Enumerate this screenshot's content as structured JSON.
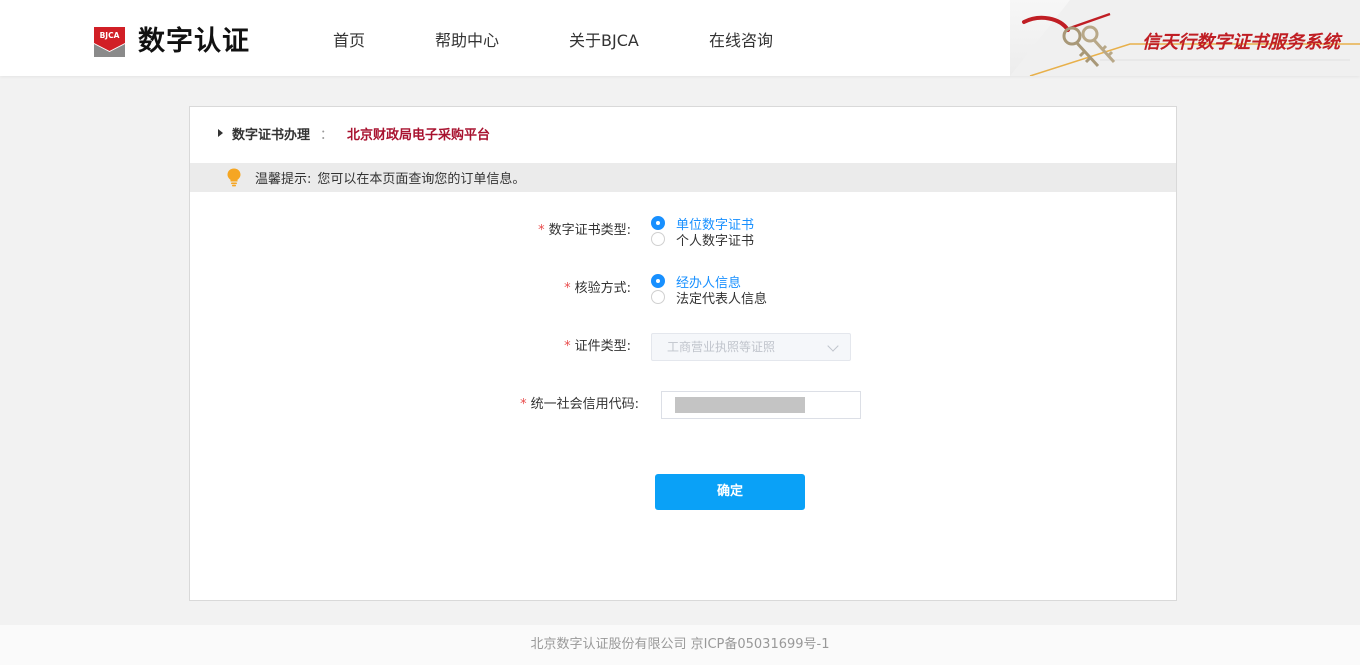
{
  "header": {
    "logo_badge": "BJCA",
    "logo_text": "数字认证",
    "nav": [
      "首页",
      "帮助中心",
      "关于BJCA",
      "在线咨询"
    ],
    "brand_title": "信天行数字证书服务系统"
  },
  "breadcrumb": {
    "main": "数字证书办理",
    "separator": "：",
    "sub": "北京财政局电子采购平台"
  },
  "tip": {
    "label": "温馨提示:",
    "text": "您可以在本页面查询您的订单信息。"
  },
  "form": {
    "cert_type": {
      "label": "数字证书类型:",
      "options": [
        "单位数字证书",
        "个人数字证书"
      ],
      "selected": "单位数字证书"
    },
    "verify_method": {
      "label": "核验方式:",
      "options": [
        "经办人信息",
        "法定代表人信息"
      ],
      "selected": "经办人信息"
    },
    "id_type": {
      "label": "证件类型:",
      "value": "工商营业执照等证照"
    },
    "credit_code": {
      "label": "统一社会信用代码:"
    },
    "required_mark": "*",
    "confirm_label": "确定"
  },
  "footer": {
    "text": "北京数字认证股份有限公司 京ICP备05031699号-1"
  },
  "colors": {
    "accent": "#1890ff",
    "button": "#0aa1f7",
    "brand_red": "#c01e24",
    "crumb_red": "#a8122f",
    "required": "#e94b4b"
  }
}
